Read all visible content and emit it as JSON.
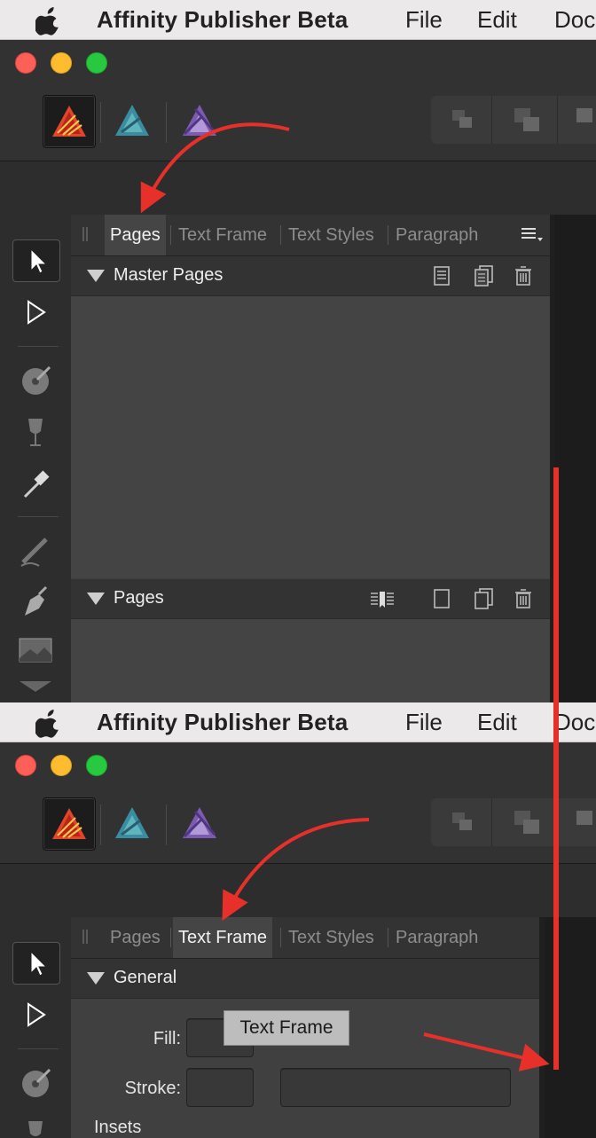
{
  "menubar": {
    "app_name": "Affinity Publisher Beta",
    "items": [
      "File",
      "Edit",
      "Doc"
    ]
  },
  "panel_before": {
    "tabs": [
      {
        "label": "Pages",
        "active": true
      },
      {
        "label": "Text Frame",
        "active": false
      },
      {
        "label": "Text Styles",
        "active": false
      },
      {
        "label": "Paragraph",
        "active": false
      }
    ],
    "sections": [
      {
        "label": "Master Pages",
        "icons": [
          "page-icon",
          "duplicate-page-icon",
          "trash-icon"
        ]
      },
      {
        "label": "Pages",
        "icons": [
          "insert-pages-icon",
          "page-icon",
          "duplicate-page-icon",
          "trash-icon"
        ]
      }
    ]
  },
  "panel_after": {
    "tabs": [
      {
        "label": "Pages",
        "active": false
      },
      {
        "label": "Text Frame",
        "active": true
      },
      {
        "label": "Text Styles",
        "active": false
      },
      {
        "label": "Paragraph",
        "active": false
      }
    ],
    "tooltip": "Text Frame",
    "general": {
      "label": "General",
      "fill_label": "Fill:",
      "stroke_label": "Stroke:",
      "insets_label": "Insets"
    }
  },
  "personas": [
    "publisher-persona-icon",
    "designer-persona-icon",
    "photo-persona-icon"
  ],
  "colors": {
    "annotation_red": "#e8302a",
    "publisher_orange": "#e2452a"
  }
}
